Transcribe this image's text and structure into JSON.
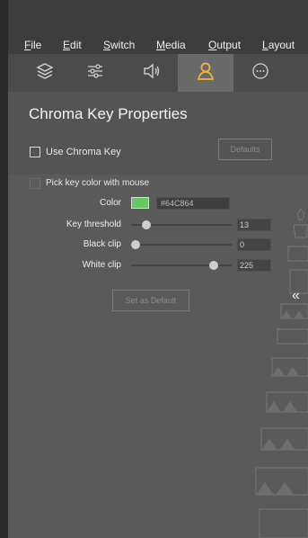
{
  "menu": {
    "file": {
      "ul": "F",
      "rest": "ile"
    },
    "edit": {
      "ul": "E",
      "rest": "dit"
    },
    "switch": {
      "ul": "S",
      "rest": "witch"
    },
    "media": {
      "ul": "M",
      "rest": "edia"
    },
    "output": {
      "ul": "O",
      "rest": "utput"
    },
    "layout": {
      "ul": "L",
      "rest": "ayout"
    }
  },
  "tabs": [
    {
      "icon": "layers-icon"
    },
    {
      "icon": "sliders-icon"
    },
    {
      "icon": "audio-icon"
    },
    {
      "icon": "person-icon",
      "active": true
    },
    {
      "icon": "more-icon"
    }
  ],
  "panel": {
    "title": "Chroma Key Properties",
    "use_chroma_key": "Use Chroma Key",
    "defaults": "Defaults",
    "pick_key_color": "Pick key color with mouse",
    "color_label": "Color",
    "color_hex": "#64C864",
    "key_threshold_label": "Key threshold",
    "key_threshold_value": "13",
    "black_clip_label": "Black clip",
    "black_clip_value": "0",
    "white_clip_label": "White clip",
    "white_clip_value": "225",
    "set_as_default": "Set as Default",
    "collapse_glyph": "«"
  },
  "colors": {
    "swatch": "#64C864"
  }
}
